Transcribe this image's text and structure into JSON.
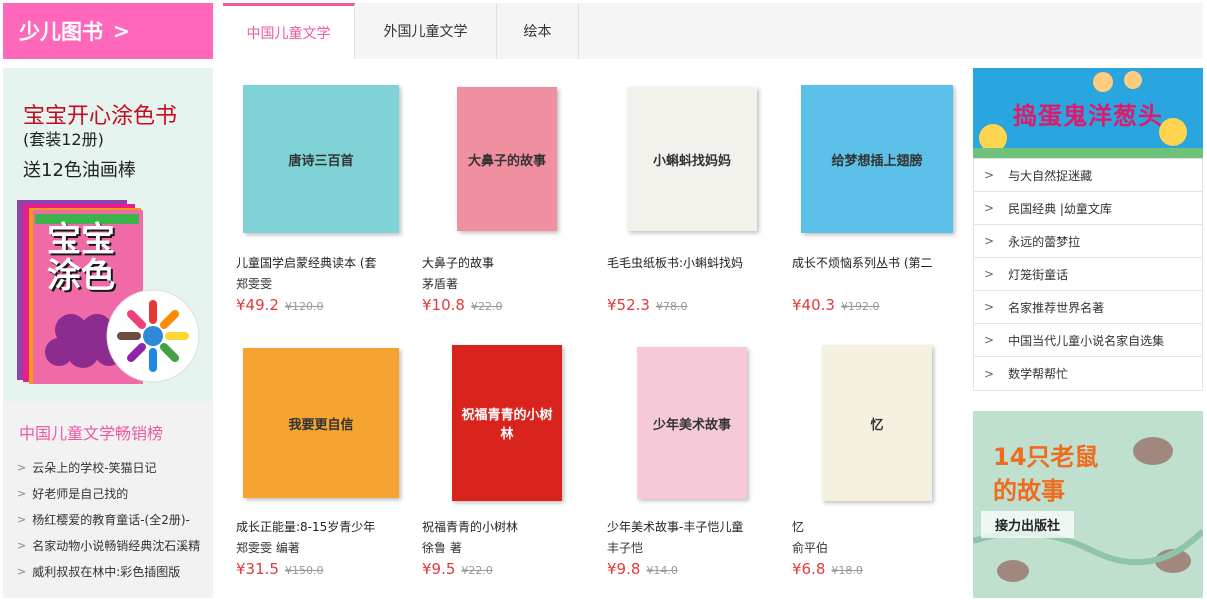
{
  "header": {
    "title": "少儿图书",
    "chevron": ">"
  },
  "tabs": [
    {
      "label": "中国儿童文学"
    },
    {
      "label": "外国儿童文学"
    },
    {
      "label": "绘本"
    }
  ],
  "left_banner": {
    "line1": "宝宝开心涂色书",
    "line2": "(套装12册)",
    "line3": "送12色油画棒",
    "cover_text": "宝宝涂色"
  },
  "bestsellers": {
    "title": "中国儿童文学畅销榜",
    "items": [
      "云朵上的学校-笑猫日记",
      "好老师是自己找的",
      "杨红樱爱的教育童话-(全2册)-",
      "名家动物小说畅销经典沈石溪精",
      "威利叔叔在林中:彩色插图版"
    ]
  },
  "books": [
    {
      "title": "儿童国学启蒙经典读本 (套",
      "author": "郑雯雯",
      "price": "¥49.2",
      "old": "¥120.0",
      "cover_text": "唐诗三百首",
      "color": "#7fd3d6"
    },
    {
      "title": "大鼻子的故事",
      "author": "茅盾著",
      "price": "¥10.8",
      "old": "¥22.0",
      "cover_text": "大鼻子的故事",
      "color": "#ef8fa0"
    },
    {
      "title": "毛毛虫纸板书:小蝌蚪找妈",
      "author": "",
      "price": "¥52.3",
      "old": "¥78.0",
      "cover_text": "小蝌蚪找妈妈",
      "color": "#f3f1ec"
    },
    {
      "title": "成长不烦恼系列丛书 (第二",
      "author": "",
      "price": "¥40.3",
      "old": "¥192.0",
      "cover_text": "给梦想插上翅膀",
      "color": "#5cc0e8"
    },
    {
      "title": "成长正能量:8-15岁青少年",
      "author": "郑雯雯 编著",
      "price": "¥31.5",
      "old": "¥150.0",
      "cover_text": "我要更自信",
      "color": "#f5a431"
    },
    {
      "title": "祝福青青的小树林",
      "author": "徐鲁 著",
      "price": "¥9.5",
      "old": "¥22.0",
      "cover_text": "祝福青青的小树林",
      "color": "#d8241d"
    },
    {
      "title": "少年美术故事-丰子恺儿童",
      "author": "丰子恺",
      "price": "¥9.8",
      "old": "¥14.0",
      "cover_text": "少年美术故事",
      "color": "#f6c9d8"
    },
    {
      "title": "忆",
      "author": "俞平伯",
      "price": "¥6.8",
      "old": "¥18.0",
      "cover_text": "忆",
      "color": "#f4f1e0"
    }
  ],
  "right_ad1": {
    "title": "捣蛋鬼洋葱头"
  },
  "categories": [
    "与大自然捉迷藏",
    "民国经典 |幼童文库",
    "永远的蕾梦拉",
    "灯笼街童话",
    "名家推荐世界名著",
    "中国当代儿童小说名家自选集",
    "数学帮帮忙"
  ],
  "right_ad2": {
    "line1": "14只老鼠",
    "line2": "的故事",
    "publisher": "接力出版社"
  },
  "colors": {
    "accent": "#ff67bb",
    "price": "#e4393c",
    "tab_active": "#ee59a5"
  }
}
